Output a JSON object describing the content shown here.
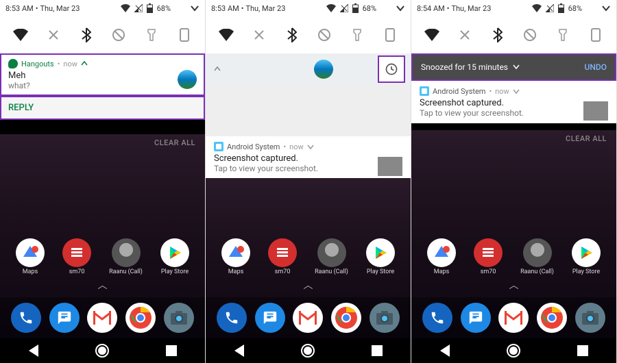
{
  "panels": [
    {
      "time": "8:53 AM",
      "date": "Thu, Mar 23",
      "battery": "68%"
    },
    {
      "time": "8:53 AM",
      "date": "Thu, Mar 23",
      "battery": "68%"
    },
    {
      "time": "8:54 AM",
      "date": "Thu, Mar 23",
      "battery": "68%"
    }
  ],
  "hangouts": {
    "app": "Hangouts",
    "time": "now",
    "title": "Meh",
    "body": "what?",
    "reply": "REPLY"
  },
  "screenshot_notif": {
    "app": "Android System",
    "time": "now",
    "title": "Screenshot captured.",
    "body": "Tap to view your screenshot."
  },
  "snooze": {
    "text": "Snoozed for 15 minutes",
    "undo": "UNDO"
  },
  "clear_all": "CLEAR ALL",
  "apps": [
    {
      "label": "Maps"
    },
    {
      "label": "sm70"
    },
    {
      "label": "Raanu (Call)"
    },
    {
      "label": "Play Store"
    }
  ],
  "colors": {
    "highlight": "#7a2fb5",
    "hangouts": "#0b8043"
  }
}
